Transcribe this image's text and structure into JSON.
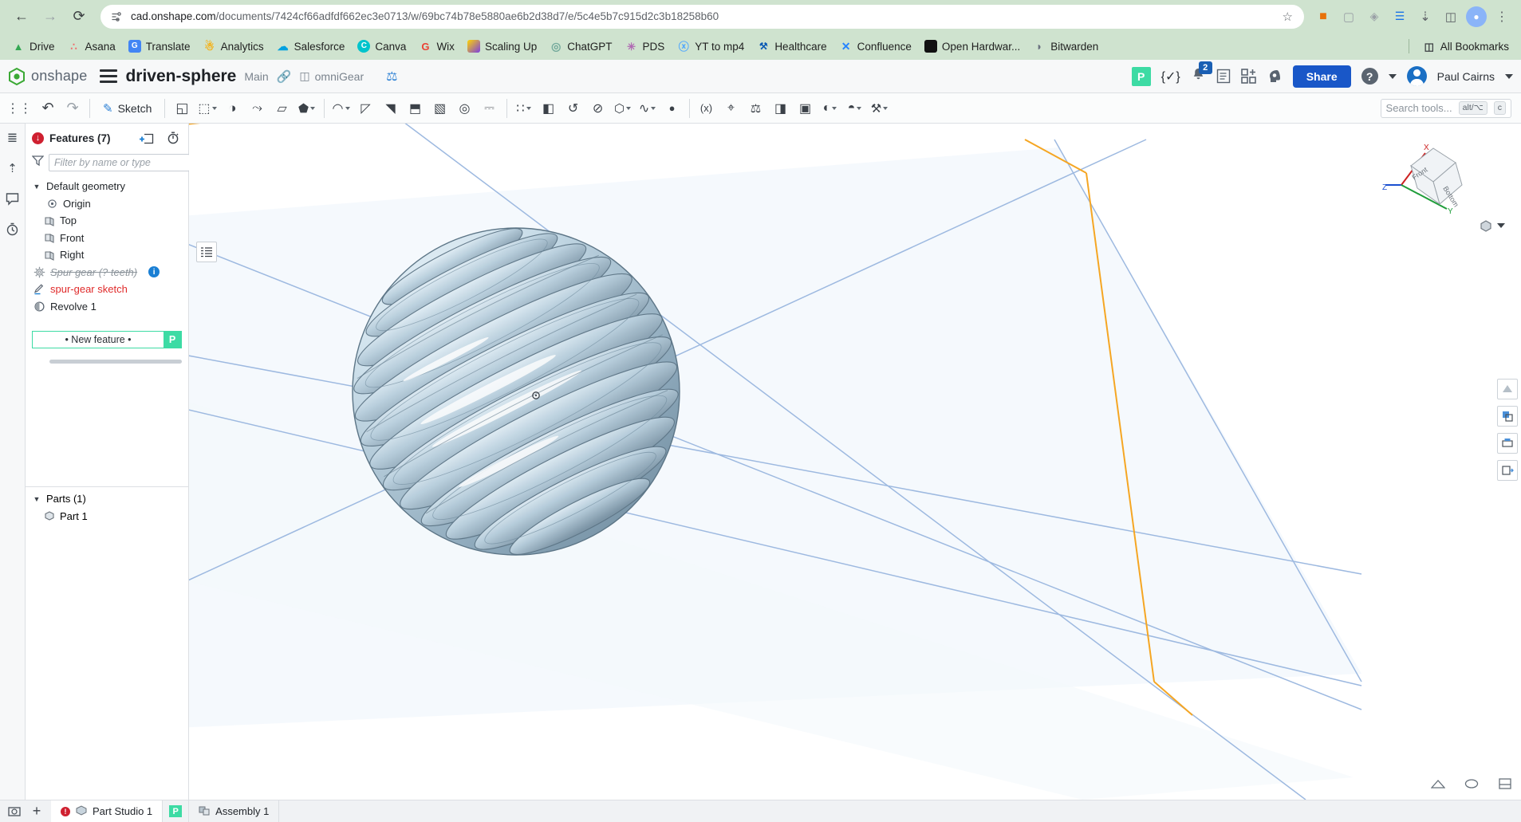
{
  "browser": {
    "url_host": "cad.onshape.com",
    "url_path": "/documents/7424cf66adfdf662ec3e0713/w/69bc74b78e5880ae6b2d38d7/e/5c4e5b7c915d2c3b18258b60",
    "back_icon": "back-arrow-icon",
    "forward_icon": "forward-arrow-icon",
    "reload_icon": "reload-icon",
    "site_info_icon": "site-settings-icon",
    "star_icon": "bookmark-star-icon",
    "all_bookmarks_label": "All Bookmarks",
    "bookmarks": [
      {
        "label": "Drive",
        "icon": "google-drive-icon",
        "color": "#ffc107",
        "glyph": "▲"
      },
      {
        "label": "Asana",
        "icon": "asana-icon",
        "color": "#f06a6a",
        "glyph": "∴"
      },
      {
        "label": "Translate",
        "icon": "google-translate-icon",
        "color": "#4285f4",
        "glyph": "G"
      },
      {
        "label": "Analytics",
        "icon": "google-analytics-icon",
        "color": "#f9ab00",
        "glyph": "▃"
      },
      {
        "label": "Salesforce",
        "icon": "salesforce-cloud-icon",
        "color": "#00a1e0",
        "glyph": "☁"
      },
      {
        "label": "Canva",
        "icon": "canva-icon",
        "color": "#00c4cc",
        "glyph": "C"
      },
      {
        "label": "Wix",
        "icon": "wix-icon",
        "color": "#ea4335",
        "glyph": "G"
      },
      {
        "label": "Scaling Up",
        "icon": "scaling-up-icon",
        "color": "#7b3fe4",
        "glyph": "◢"
      },
      {
        "label": "ChatGPT",
        "icon": "chatgpt-icon",
        "color": "#74aa9c",
        "glyph": "◎"
      },
      {
        "label": "PDS",
        "icon": "pds-icon",
        "color": "#b06ab3",
        "glyph": "✳"
      },
      {
        "label": "YT to mp4",
        "icon": "yt-to-mp4-icon",
        "color": "#4da6ff",
        "glyph": "↓"
      },
      {
        "label": "Healthcare",
        "icon": "healthcare-icon",
        "color": "#0a5ab4",
        "glyph": "⊕"
      },
      {
        "label": "Confluence",
        "icon": "confluence-icon",
        "color": "#2684ff",
        "glyph": "✕"
      },
      {
        "label": "Open Hardwar...",
        "icon": "open-hardware-icon",
        "color": "#1a1a1a",
        "glyph": "■"
      },
      {
        "label": "Bitwarden",
        "icon": "bitwarden-icon",
        "color": "#6b7280",
        "glyph": "◗"
      }
    ],
    "extensions": [
      {
        "icon": "extension-orange-icon",
        "glyph": "🧳",
        "color": "#e8710a"
      },
      {
        "icon": "extension-gray-icon",
        "glyph": "▢",
        "color": "#9aa0a6"
      },
      {
        "icon": "extension-puzzle-icon",
        "glyph": "◈",
        "color": "#5f6368"
      },
      {
        "icon": "extension-blue-icon",
        "glyph": "☰",
        "color": "#1a73e8"
      },
      {
        "icon": "downloads-icon",
        "glyph": "⤓",
        "color": "#5f6368"
      },
      {
        "icon": "split-view-icon",
        "glyph": "◫",
        "color": "#5f6368"
      },
      {
        "icon": "profile-avatar-icon",
        "glyph": "●",
        "color": "#8ab4f8"
      },
      {
        "icon": "chrome-menu-icon",
        "glyph": "⋮",
        "color": "#5f6368"
      }
    ]
  },
  "header": {
    "logo_text": "onshape",
    "logo_icon": "onshape-logo-icon",
    "menu_icon": "hamburger-menu-icon",
    "document_title": "driven-sphere",
    "branch": "Main",
    "link_icon": "link-icon",
    "folder_icon": "folder-icon",
    "folder_name": "omniGear",
    "ruler_icon": "measure-tool-icon",
    "premium_badge": "P",
    "feature_script_icon": "featurescript-icon",
    "feature_script_glyph": "{✓}",
    "notifications_icon": "notification-bell-icon",
    "notifications_count": "2",
    "tasks_icon": "tasks-list-icon",
    "apps_icon": "add-app-icon",
    "ai_icon": "ai-assistant-icon",
    "share_label": "Share",
    "help_label": "?",
    "help_icon": "help-icon",
    "user_name": "Paul Cairns",
    "avatar_icon": "user-avatar-icon"
  },
  "toolbar": {
    "undo_icon": "undo-icon",
    "redo_icon": "redo-icon",
    "sketch_label": "Sketch",
    "sketch_icon": "sketch-pencil-icon",
    "search_placeholder": "Search tools...",
    "search_kbd_1": "alt/⌥",
    "search_kbd_2": "c",
    "search_icon": "search-icon",
    "tools": [
      {
        "name": "plane-tool",
        "glyph": "◱",
        "caret": false
      },
      {
        "name": "extrude-tool",
        "glyph": "⬚",
        "caret": true
      },
      {
        "name": "revolve-tool",
        "glyph": "◑",
        "caret": false
      },
      {
        "name": "sweep-tool",
        "glyph": "⤳",
        "caret": false
      },
      {
        "name": "loft-tool",
        "glyph": "▱",
        "caret": false
      },
      {
        "name": "boolean-tool",
        "glyph": "⬟",
        "caret": true
      },
      {
        "name": "fillet-tool",
        "glyph": "◠",
        "caret": true
      },
      {
        "name": "chamfer-tool",
        "glyph": "◸",
        "caret": false
      },
      {
        "name": "draft-tool",
        "glyph": "◥",
        "caret": false
      },
      {
        "name": "rib-tool",
        "glyph": "⬒",
        "caret": false
      },
      {
        "name": "shell-tool",
        "glyph": "▧",
        "caret": true
      },
      {
        "name": "hole-tool",
        "glyph": "◎",
        "caret": false
      },
      {
        "name": "thread-tool",
        "glyph": "⎓",
        "caret": false
      },
      {
        "name": "pattern-tool",
        "glyph": "∷",
        "caret": true
      },
      {
        "name": "mirror-tool",
        "glyph": "◧",
        "caret": false
      },
      {
        "name": "transform-tool",
        "glyph": "↺",
        "caret": false
      },
      {
        "name": "split-tool",
        "glyph": "⊘",
        "caret": false
      },
      {
        "name": "sheet-metal-tool",
        "glyph": "⬡",
        "caret": true
      },
      {
        "name": "curve-tool",
        "glyph": "∿",
        "caret": true
      },
      {
        "name": "reference-tool",
        "glyph": "●",
        "caret": false
      },
      {
        "name": "part-tool",
        "glyph": "⬛",
        "caret": false
      },
      {
        "name": "variable-tool",
        "glyph": "(x)",
        "caret": false
      },
      {
        "name": "measure-tool",
        "glyph": "⌖",
        "caret": false
      },
      {
        "name": "mass-tool",
        "glyph": "⚖",
        "caret": false
      },
      {
        "name": "section-tool",
        "glyph": "◨",
        "caret": false
      },
      {
        "name": "display-tool",
        "glyph": "▣",
        "caret": false
      },
      {
        "name": "appearance-tool",
        "glyph": "◐",
        "caret": true
      },
      {
        "name": "render-tool",
        "glyph": "◓",
        "caret": true
      },
      {
        "name": "insert-tool",
        "glyph": "⚒",
        "caret": true
      }
    ]
  },
  "left_rail": [
    {
      "name": "feature-list-rail-icon",
      "glyph": "≡"
    },
    {
      "name": "add-part-rail-icon",
      "glyph": "↑"
    },
    {
      "name": "comments-rail-icon",
      "glyph": "💬"
    },
    {
      "name": "history-rail-icon",
      "glyph": "⏱"
    }
  ],
  "features_panel": {
    "error_badge": "!",
    "error_icon": "error-circle-icon",
    "title": "Features (7)",
    "new_folder_icon": "new-folder-icon",
    "rollback_icon": "rollback-timer-icon",
    "filter_icon": "filter-funnel-icon",
    "filter_placeholder": "Filter by name or type",
    "tree": [
      {
        "label": "Default geometry",
        "icon": "folder-group-icon",
        "twisty": "⌄",
        "indent": 0,
        "state": "normal"
      },
      {
        "label": "Origin",
        "icon": "origin-icon",
        "twisty": "",
        "indent": 1,
        "state": "normal"
      },
      {
        "label": "Top",
        "icon": "plane-icon",
        "twisty": "",
        "indent": 1,
        "state": "normal"
      },
      {
        "label": "Front",
        "icon": "plane-icon",
        "twisty": "",
        "indent": 1,
        "state": "normal"
      },
      {
        "label": "Right",
        "icon": "plane-icon",
        "twisty": "",
        "indent": 1,
        "state": "normal"
      },
      {
        "label": "Spur gear (? teeth)",
        "icon": "gear-feature-icon",
        "twisty": "",
        "indent": 0,
        "state": "suppressed",
        "info": "i"
      },
      {
        "label": "spur-gear sketch",
        "icon": "sketch-pencil-icon",
        "twisty": "",
        "indent": 0,
        "state": "error"
      },
      {
        "label": "Revolve 1",
        "icon": "revolve-icon",
        "twisty": "",
        "indent": 0,
        "state": "normal"
      }
    ],
    "new_feature_label": "• New feature •",
    "new_feature_badge": "P",
    "parts_title": "Parts (1)",
    "parts_twisty": "⌄",
    "parts": [
      {
        "label": "Part 1",
        "icon": "part-solid-icon"
      }
    ],
    "flyout_icon": "feature-list-flyout-icon"
  },
  "viewport": {
    "view_cube": {
      "axis_x": "X",
      "axis_y": "Y",
      "axis_z": "Z",
      "face_front": "Front",
      "face_bottom": "Bottom",
      "cube_icon": "view-cube-icon",
      "dropdown_icon": "view-orientation-dropdown-icon"
    },
    "right_tools": [
      {
        "name": "appearance-viewport-icon",
        "glyph": "◤"
      },
      {
        "name": "render-viewport-icon",
        "glyph": "◰"
      },
      {
        "name": "print-viewport-icon",
        "glyph": "⎙"
      },
      {
        "name": "export-viewport-icon",
        "glyph": "⭳"
      }
    ],
    "bottom_tools": [
      {
        "name": "section-view-icon",
        "glyph": "◢"
      },
      {
        "name": "zoom-fit-icon",
        "glyph": "◯"
      },
      {
        "name": "display-state-icon",
        "glyph": "▤"
      }
    ],
    "colors": {
      "part_light": "#cfe3ee",
      "part_mid": "#9db8c8",
      "part_dark": "#6f8a9c",
      "plane_line": "#9db9e0",
      "plane_fill": "#eef4fb",
      "highlight_orange": "#f5a623"
    }
  },
  "tabbar": {
    "screenshot_icon": "screenshot-icon",
    "add_tab_icon": "add-tab-icon",
    "tabs": [
      {
        "label": "Part Studio 1",
        "icon": "part-studio-icon",
        "active": true,
        "error": true,
        "badge": ""
      },
      {
        "label": "Assembly 1",
        "icon": "assembly-icon",
        "active": false,
        "error": false,
        "badge": "P"
      }
    ],
    "badge_p": "P"
  }
}
